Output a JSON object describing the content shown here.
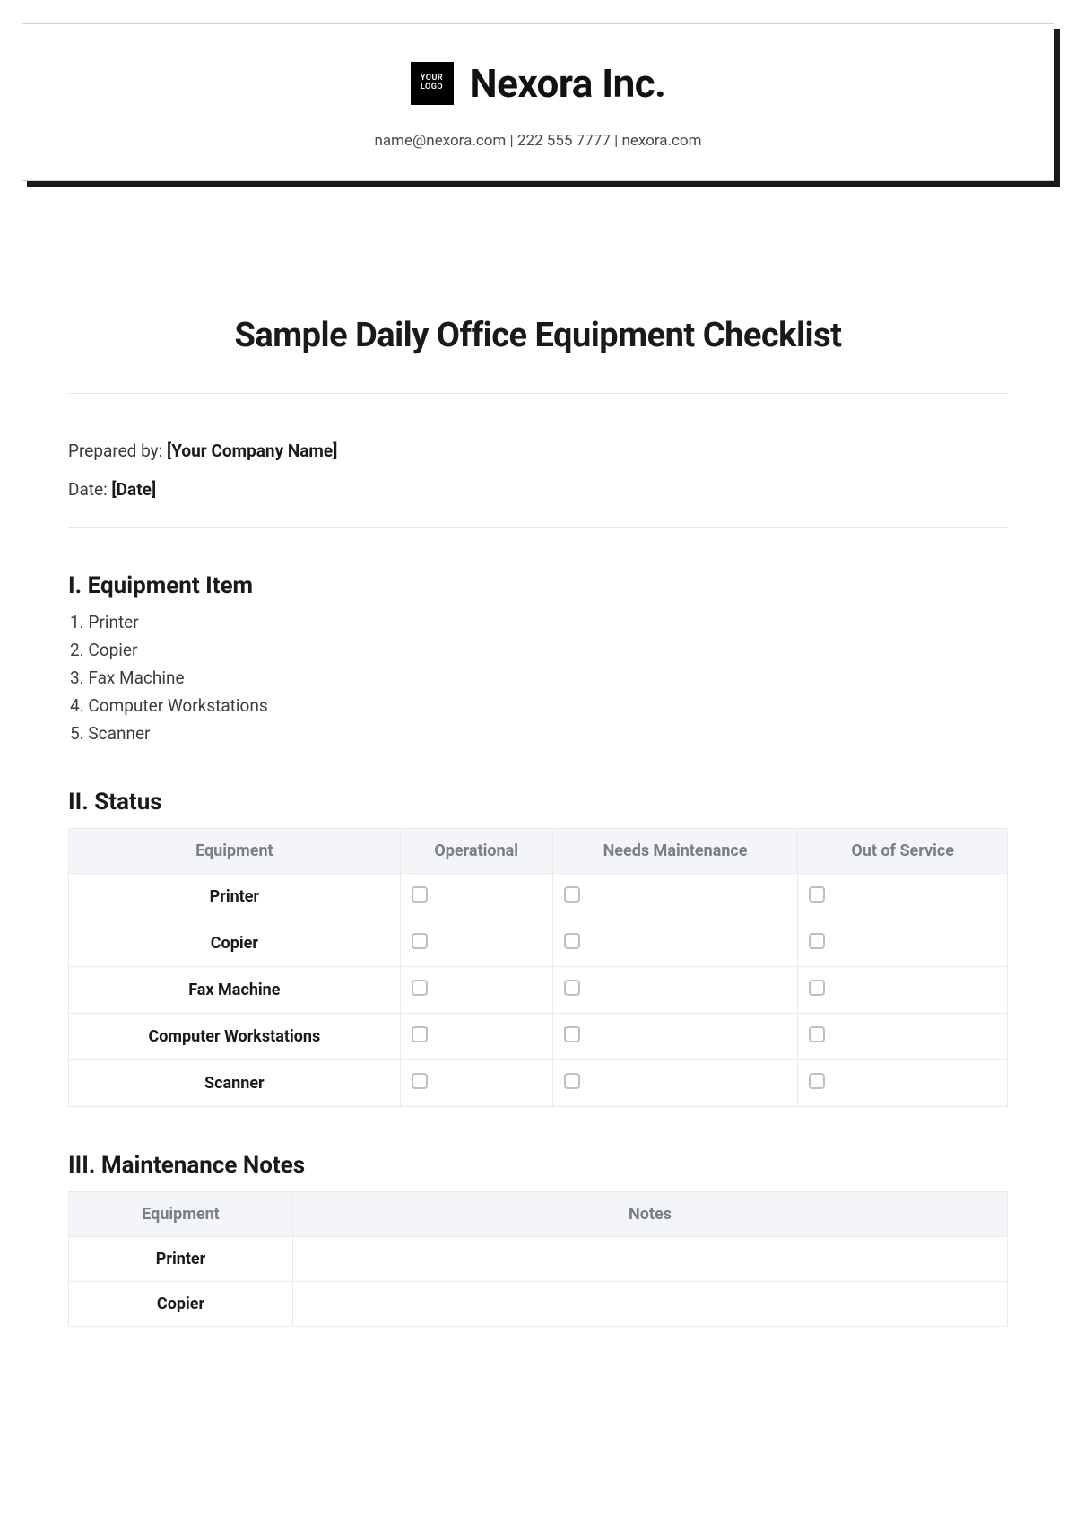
{
  "header": {
    "logo_line1": "YOUR",
    "logo_line2": "LOGO",
    "company_name": "Nexora Inc.",
    "contact_line": "name@nexora.com | 222 555 7777 | nexora.com"
  },
  "title": "Sample Daily Office Equipment Checklist",
  "meta": {
    "prepared_by_label": "Prepared by:",
    "prepared_by_value": "[Your Company Name]",
    "date_label": "Date:",
    "date_value": "[Date]"
  },
  "section1": {
    "heading": "I. Equipment Item",
    "items": [
      "1. Printer",
      "2. Copier",
      "3. Fax Machine",
      "4. Computer Workstations",
      "5. Scanner"
    ]
  },
  "section2": {
    "heading": "II. Status",
    "columns": [
      "Equipment",
      "Operational",
      "Needs Maintenance",
      "Out of Service"
    ],
    "rows": [
      "Printer",
      "Copier",
      "Fax Machine",
      "Computer Workstations",
      "Scanner"
    ]
  },
  "section3": {
    "heading": "III. Maintenance Notes",
    "columns": [
      "Equipment",
      "Notes"
    ],
    "rows": [
      "Printer",
      "Copier"
    ]
  }
}
